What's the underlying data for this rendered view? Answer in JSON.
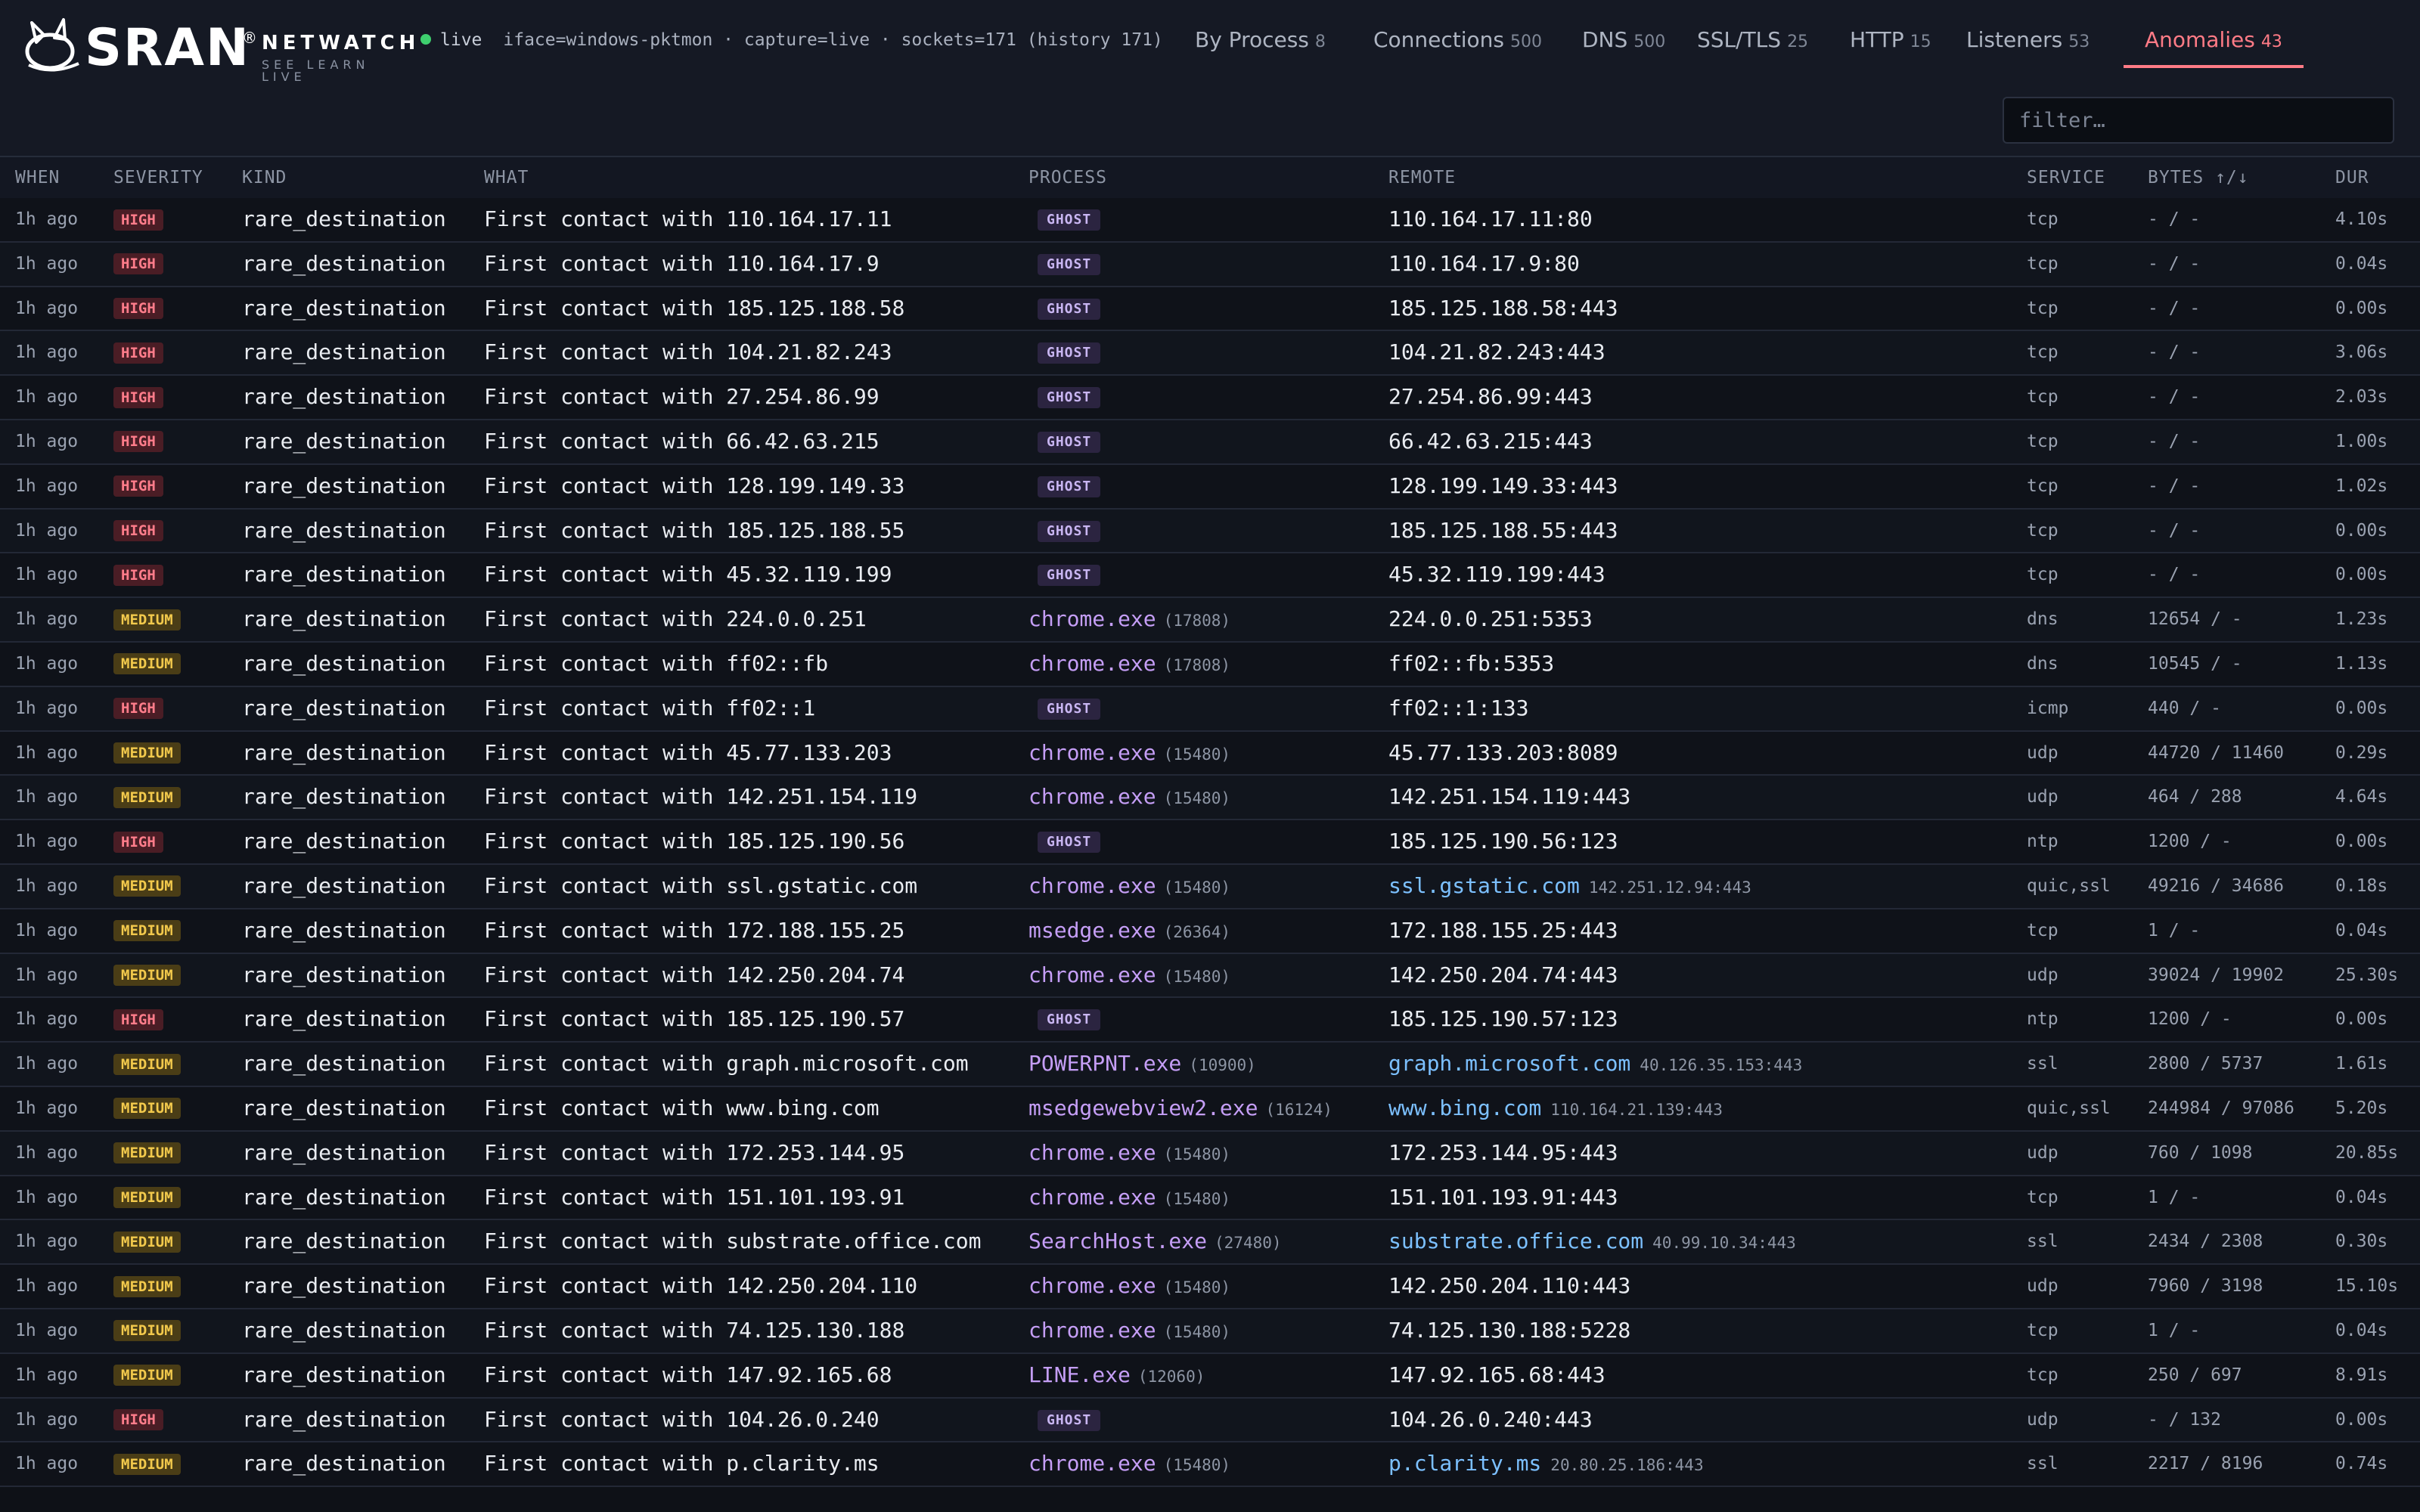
{
  "brand": {
    "name": "SRAN",
    "reg": "®",
    "product": "NETWATCH",
    "tagline": "SEE LEARN LIVE"
  },
  "status": {
    "live_label": "live",
    "detail": "iface=windows-pktmon · capture=live · sockets=171 (history 171)"
  },
  "tabs": [
    {
      "label": "By Process",
      "count": "8",
      "active": false
    },
    {
      "label": "Connections",
      "count": "500",
      "active": false
    },
    {
      "label": "DNS",
      "count": "500",
      "active": false
    },
    {
      "label": "SSL/TLS",
      "count": "25",
      "active": false
    },
    {
      "label": "HTTP",
      "count": "15",
      "active": false
    },
    {
      "label": "Listeners",
      "count": "53",
      "active": false
    },
    {
      "label": "Anomalies",
      "count": "43",
      "active": true
    }
  ],
  "filter": {
    "placeholder": "filter…",
    "value": ""
  },
  "columns": [
    "WHEN",
    "SEVERITY",
    "KIND",
    "WHAT",
    "PROCESS",
    "REMOTE",
    "SERVICE",
    "BYTES ↑/↓",
    "DUR"
  ],
  "colors": {
    "accent": "#ff7b86",
    "high": "#ff7d8b",
    "medium": "#f2c94c",
    "process": "#c59ef6",
    "host": "#7cc0ff",
    "live": "#3ecf6e"
  },
  "rows": [
    {
      "when": "1h ago",
      "severity": "HIGH",
      "kind": "rare_destination",
      "what": "First contact with 110.164.17.11",
      "process": "GHOST",
      "pid": "",
      "remote": "110.164.17.11:80",
      "remote_host": "",
      "service": "tcp",
      "bytes": "- / -",
      "dur": "4.10s"
    },
    {
      "when": "1h ago",
      "severity": "HIGH",
      "kind": "rare_destination",
      "what": "First contact with 110.164.17.9",
      "process": "GHOST",
      "pid": "",
      "remote": "110.164.17.9:80",
      "remote_host": "",
      "service": "tcp",
      "bytes": "- / -",
      "dur": "0.04s"
    },
    {
      "when": "1h ago",
      "severity": "HIGH",
      "kind": "rare_destination",
      "what": "First contact with 185.125.188.58",
      "process": "GHOST",
      "pid": "",
      "remote": "185.125.188.58:443",
      "remote_host": "",
      "service": "tcp",
      "bytes": "- / -",
      "dur": "0.00s"
    },
    {
      "when": "1h ago",
      "severity": "HIGH",
      "kind": "rare_destination",
      "what": "First contact with 104.21.82.243",
      "process": "GHOST",
      "pid": "",
      "remote": "104.21.82.243:443",
      "remote_host": "",
      "service": "tcp",
      "bytes": "- / -",
      "dur": "3.06s"
    },
    {
      "when": "1h ago",
      "severity": "HIGH",
      "kind": "rare_destination",
      "what": "First contact with 27.254.86.99",
      "process": "GHOST",
      "pid": "",
      "remote": "27.254.86.99:443",
      "remote_host": "",
      "service": "tcp",
      "bytes": "- / -",
      "dur": "2.03s"
    },
    {
      "when": "1h ago",
      "severity": "HIGH",
      "kind": "rare_destination",
      "what": "First contact with 66.42.63.215",
      "process": "GHOST",
      "pid": "",
      "remote": "66.42.63.215:443",
      "remote_host": "",
      "service": "tcp",
      "bytes": "- / -",
      "dur": "1.00s"
    },
    {
      "when": "1h ago",
      "severity": "HIGH",
      "kind": "rare_destination",
      "what": "First contact with 128.199.149.33",
      "process": "GHOST",
      "pid": "",
      "remote": "128.199.149.33:443",
      "remote_host": "",
      "service": "tcp",
      "bytes": "- / -",
      "dur": "1.02s"
    },
    {
      "when": "1h ago",
      "severity": "HIGH",
      "kind": "rare_destination",
      "what": "First contact with 185.125.188.55",
      "process": "GHOST",
      "pid": "",
      "remote": "185.125.188.55:443",
      "remote_host": "",
      "service": "tcp",
      "bytes": "- / -",
      "dur": "0.00s"
    },
    {
      "when": "1h ago",
      "severity": "HIGH",
      "kind": "rare_destination",
      "what": "First contact with 45.32.119.199",
      "process": "GHOST",
      "pid": "",
      "remote": "45.32.119.199:443",
      "remote_host": "",
      "service": "tcp",
      "bytes": "- / -",
      "dur": "0.00s"
    },
    {
      "when": "1h ago",
      "severity": "MEDIUM",
      "kind": "rare_destination",
      "what": "First contact with 224.0.0.251",
      "process": "chrome.exe",
      "pid": "(17808)",
      "remote": "224.0.0.251:5353",
      "remote_host": "",
      "service": "dns",
      "bytes": "12654 / -",
      "dur": "1.23s"
    },
    {
      "when": "1h ago",
      "severity": "MEDIUM",
      "kind": "rare_destination",
      "what": "First contact with ff02::fb",
      "process": "chrome.exe",
      "pid": "(17808)",
      "remote": "ff02::fb:5353",
      "remote_host": "",
      "service": "dns",
      "bytes": "10545 / -",
      "dur": "1.13s"
    },
    {
      "when": "1h ago",
      "severity": "HIGH",
      "kind": "rare_destination",
      "what": "First contact with ff02::1",
      "process": "GHOST",
      "pid": "",
      "remote": "ff02::1:133",
      "remote_host": "",
      "service": "icmp",
      "bytes": "440 / -",
      "dur": "0.00s"
    },
    {
      "when": "1h ago",
      "severity": "MEDIUM",
      "kind": "rare_destination",
      "what": "First contact with 45.77.133.203",
      "process": "chrome.exe",
      "pid": "(15480)",
      "remote": "45.77.133.203:8089",
      "remote_host": "",
      "service": "udp",
      "bytes": "44720 / 11460",
      "dur": "0.29s"
    },
    {
      "when": "1h ago",
      "severity": "MEDIUM",
      "kind": "rare_destination",
      "what": "First contact with 142.251.154.119",
      "process": "chrome.exe",
      "pid": "(15480)",
      "remote": "142.251.154.119:443",
      "remote_host": "",
      "service": "udp",
      "bytes": "464 / 288",
      "dur": "4.64s"
    },
    {
      "when": "1h ago",
      "severity": "HIGH",
      "kind": "rare_destination",
      "what": "First contact with 185.125.190.56",
      "process": "GHOST",
      "pid": "",
      "remote": "185.125.190.56:123",
      "remote_host": "",
      "service": "ntp",
      "bytes": "1200 / -",
      "dur": "0.00s"
    },
    {
      "when": "1h ago",
      "severity": "MEDIUM",
      "kind": "rare_destination",
      "what": "First contact with ssl.gstatic.com",
      "process": "chrome.exe",
      "pid": "(15480)",
      "remote": "142.251.12.94:443",
      "remote_host": "ssl.gstatic.com",
      "service": "quic,ssl",
      "bytes": "49216 / 34686",
      "dur": "0.18s"
    },
    {
      "when": "1h ago",
      "severity": "MEDIUM",
      "kind": "rare_destination",
      "what": "First contact with 172.188.155.25",
      "process": "msedge.exe",
      "pid": "(26364)",
      "remote": "172.188.155.25:443",
      "remote_host": "",
      "service": "tcp",
      "bytes": "1 / -",
      "dur": "0.04s"
    },
    {
      "when": "1h ago",
      "severity": "MEDIUM",
      "kind": "rare_destination",
      "what": "First contact with 142.250.204.74",
      "process": "chrome.exe",
      "pid": "(15480)",
      "remote": "142.250.204.74:443",
      "remote_host": "",
      "service": "udp",
      "bytes": "39024 / 19902",
      "dur": "25.30s"
    },
    {
      "when": "1h ago",
      "severity": "HIGH",
      "kind": "rare_destination",
      "what": "First contact with 185.125.190.57",
      "process": "GHOST",
      "pid": "",
      "remote": "185.125.190.57:123",
      "remote_host": "",
      "service": "ntp",
      "bytes": "1200 / -",
      "dur": "0.00s"
    },
    {
      "when": "1h ago",
      "severity": "MEDIUM",
      "kind": "rare_destination",
      "what": "First contact with graph.microsoft.com",
      "process": "POWERPNT.exe",
      "pid": "(10900)",
      "remote": "40.126.35.153:443",
      "remote_host": "graph.microsoft.com",
      "service": "ssl",
      "bytes": "2800 / 5737",
      "dur": "1.61s"
    },
    {
      "when": "1h ago",
      "severity": "MEDIUM",
      "kind": "rare_destination",
      "what": "First contact with www.bing.com",
      "process": "msedgewebview2.exe",
      "pid": "(16124)",
      "remote": "110.164.21.139:443",
      "remote_host": "www.bing.com",
      "service": "quic,ssl",
      "bytes": "244984 / 97086",
      "dur": "5.20s"
    },
    {
      "when": "1h ago",
      "severity": "MEDIUM",
      "kind": "rare_destination",
      "what": "First contact with 172.253.144.95",
      "process": "chrome.exe",
      "pid": "(15480)",
      "remote": "172.253.144.95:443",
      "remote_host": "",
      "service": "udp",
      "bytes": "760 / 1098",
      "dur": "20.85s"
    },
    {
      "when": "1h ago",
      "severity": "MEDIUM",
      "kind": "rare_destination",
      "what": "First contact with 151.101.193.91",
      "process": "chrome.exe",
      "pid": "(15480)",
      "remote": "151.101.193.91:443",
      "remote_host": "",
      "service": "tcp",
      "bytes": "1 / -",
      "dur": "0.04s"
    },
    {
      "when": "1h ago",
      "severity": "MEDIUM",
      "kind": "rare_destination",
      "what": "First contact with substrate.office.com",
      "process": "SearchHost.exe",
      "pid": "(27480)",
      "remote": "40.99.10.34:443",
      "remote_host": "substrate.office.com",
      "service": "ssl",
      "bytes": "2434 / 2308",
      "dur": "0.30s"
    },
    {
      "when": "1h ago",
      "severity": "MEDIUM",
      "kind": "rare_destination",
      "what": "First contact with 142.250.204.110",
      "process": "chrome.exe",
      "pid": "(15480)",
      "remote": "142.250.204.110:443",
      "remote_host": "",
      "service": "udp",
      "bytes": "7960 / 3198",
      "dur": "15.10s"
    },
    {
      "when": "1h ago",
      "severity": "MEDIUM",
      "kind": "rare_destination",
      "what": "First contact with 74.125.130.188",
      "process": "chrome.exe",
      "pid": "(15480)",
      "remote": "74.125.130.188:5228",
      "remote_host": "",
      "service": "tcp",
      "bytes": "1 / -",
      "dur": "0.04s"
    },
    {
      "when": "1h ago",
      "severity": "MEDIUM",
      "kind": "rare_destination",
      "what": "First contact with 147.92.165.68",
      "process": "LINE.exe",
      "pid": "(12060)",
      "remote": "147.92.165.68:443",
      "remote_host": "",
      "service": "tcp",
      "bytes": "250 / 697",
      "dur": "8.91s"
    },
    {
      "when": "1h ago",
      "severity": "HIGH",
      "kind": "rare_destination",
      "what": "First contact with 104.26.0.240",
      "process": "GHOST",
      "pid": "",
      "remote": "104.26.0.240:443",
      "remote_host": "",
      "service": "udp",
      "bytes": "- / 132",
      "dur": "0.00s"
    },
    {
      "when": "1h ago",
      "severity": "MEDIUM",
      "kind": "rare_destination",
      "what": "First contact with p.clarity.ms",
      "process": "chrome.exe",
      "pid": "(15480)",
      "remote": "20.80.25.186:443",
      "remote_host": "p.clarity.ms",
      "service": "ssl",
      "bytes": "2217 / 8196",
      "dur": "0.74s"
    }
  ]
}
